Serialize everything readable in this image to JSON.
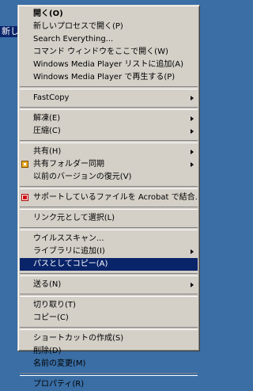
{
  "desktop": {
    "icon_label": "新しい"
  },
  "groups": [
    {
      "items": [
        {
          "label": "開く(O)",
          "bold": true
        },
        {
          "label": "新しいプロセスで開く(P)"
        },
        {
          "label": "Search Everything..."
        },
        {
          "label": "コマンド ウィンドウをここで開く(W)"
        },
        {
          "label": "Windows Media Player リストに追加(A)"
        },
        {
          "label": "Windows Media Player で再生する(P)"
        }
      ]
    },
    {
      "items": [
        {
          "label": "FastCopy",
          "submenu": true
        }
      ]
    },
    {
      "items": [
        {
          "label": "解凍(E)",
          "submenu": true
        },
        {
          "label": "圧縮(C)",
          "submenu": true
        }
      ]
    },
    {
      "items": [
        {
          "label": "共有(H)",
          "submenu": true
        },
        {
          "label": "共有フォルダー同期",
          "submenu": true,
          "icon": "shared-folder-sync-icon"
        },
        {
          "label": "以前のバージョンの復元(V)"
        }
      ]
    },
    {
      "items": [
        {
          "label": "サポートしているファイルを Acrobat で結合...",
          "icon": "acrobat-icon"
        }
      ]
    },
    {
      "items": [
        {
          "label": "リンク元として選択(L)"
        }
      ]
    },
    {
      "items": [
        {
          "label": "ウイルススキャン..."
        },
        {
          "label": "ライブラリに追加(I)",
          "submenu": true
        },
        {
          "label": "パスとしてコピー(A)",
          "selected": true
        }
      ]
    },
    {
      "items": [
        {
          "label": "送る(N)",
          "submenu": true
        }
      ]
    },
    {
      "items": [
        {
          "label": "切り取り(T)"
        },
        {
          "label": "コピー(C)"
        }
      ]
    },
    {
      "items": [
        {
          "label": "ショートカットの作成(S)"
        },
        {
          "label": "削除(D)"
        },
        {
          "label": "名前の変更(M)"
        }
      ]
    },
    {
      "items": [
        {
          "label": "プロパティ(R)"
        }
      ]
    }
  ]
}
